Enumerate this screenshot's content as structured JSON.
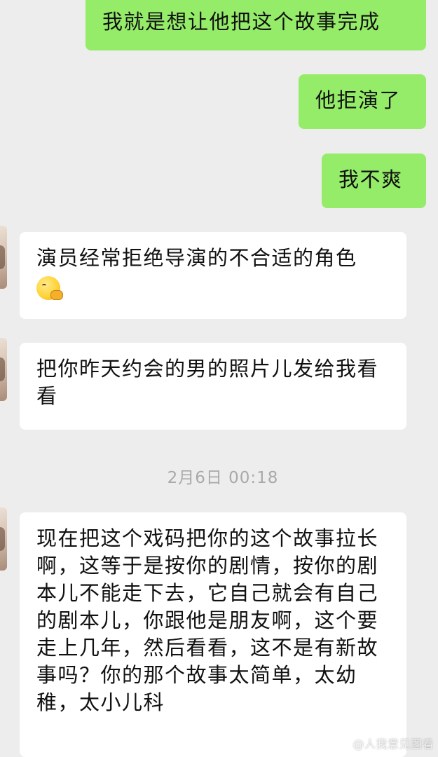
{
  "colors": {
    "background": "#ededed",
    "outgoing_bubble": "#95ec69",
    "incoming_bubble": "#ffffff",
    "timestamp_text": "#a9a9a9"
  },
  "messages_before": [
    {
      "direction": "outgoing",
      "text": "我就是想让他把这个故事完成"
    },
    {
      "direction": "outgoing",
      "text": "他拒演了"
    },
    {
      "direction": "outgoing",
      "text": "我不爽"
    },
    {
      "direction": "incoming",
      "text": "演员经常拒绝导演的不合适的角色",
      "emoji": "thinking-face-emoji"
    },
    {
      "direction": "incoming",
      "text": "把你昨天约会的男的照片儿发给我看看"
    }
  ],
  "timestamp": "2月6日 00:18",
  "messages_after": [
    {
      "direction": "incoming",
      "text": "现在把这个戏码把你的这个故事拉长啊，这等于是按你的剧情，按你的剧本儿不能走下去，它自己就会有自己的剧本儿，你跟他是朋友啊，这个要走上几年，然后看看，这不是有新故事吗？你的那个故事太简单，太幼稚，太小儿科"
    }
  ],
  "watermark": "@人我意见图看"
}
